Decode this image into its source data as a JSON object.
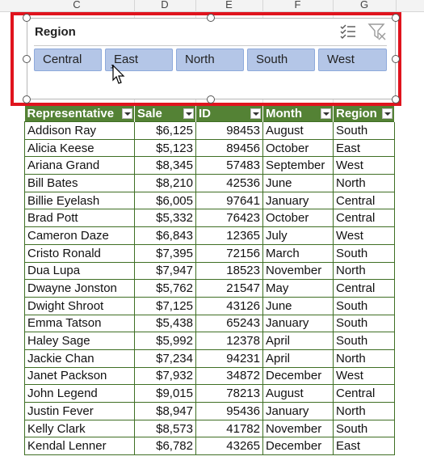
{
  "column_headers": [
    "C",
    "D",
    "E",
    "F",
    "G"
  ],
  "slicer": {
    "title": "Region",
    "buttons": [
      "Central",
      "East",
      "North",
      "South",
      "West"
    ],
    "multiselect_icon": "multi-select-icon",
    "clear_filter_icon": "clear-filter-icon",
    "button_color": "#b4c6e7"
  },
  "table": {
    "headers": [
      "Representative",
      "Sale",
      "ID",
      "Month",
      "Region"
    ],
    "header_color": "#548235",
    "rows": [
      [
        "Addison Ray",
        "$6,125",
        "98453",
        "August",
        "South"
      ],
      [
        "Alicia Keese",
        "$5,123",
        "89456",
        "October",
        "East"
      ],
      [
        "Ariana Grand",
        "$8,345",
        "57483",
        "September",
        "West"
      ],
      [
        "Bill Bates",
        "$8,210",
        "42536",
        "June",
        "North"
      ],
      [
        "Billie Eyelash",
        "$6,005",
        "97641",
        "January",
        "Central"
      ],
      [
        "Brad Pott",
        "$5,332",
        "76423",
        "October",
        "Central"
      ],
      [
        "Cameron Daze",
        "$6,843",
        "12365",
        "July",
        "West"
      ],
      [
        "Cristo Ronald",
        "$7,395",
        "72156",
        "March",
        "South"
      ],
      [
        "Dua Lupa",
        "$7,947",
        "18523",
        "November",
        "North"
      ],
      [
        "Dwayne Jonston",
        "$5,762",
        "21547",
        "May",
        "Central"
      ],
      [
        "Dwight Shroot",
        "$7,125",
        "43126",
        "June",
        "South"
      ],
      [
        "Emma Tatson",
        "$5,438",
        "65243",
        "January",
        "South"
      ],
      [
        "Haley Sage",
        "$5,992",
        "12378",
        "April",
        "South"
      ],
      [
        "Jackie Chan",
        "$7,234",
        "94231",
        "April",
        "North"
      ],
      [
        "Janet Packson",
        "$7,932",
        "34872",
        "December",
        "West"
      ],
      [
        "John Legend",
        "$9,015",
        "78213",
        "August",
        "Central"
      ],
      [
        "Justin Fever",
        "$8,947",
        "95436",
        "January",
        "North"
      ],
      [
        "Kelly Clark",
        "$8,573",
        "41782",
        "November",
        "South"
      ],
      [
        "Kendal Lenner",
        "$6,782",
        "43265",
        "December",
        "East"
      ]
    ]
  },
  "accent_red": "#e0141e"
}
